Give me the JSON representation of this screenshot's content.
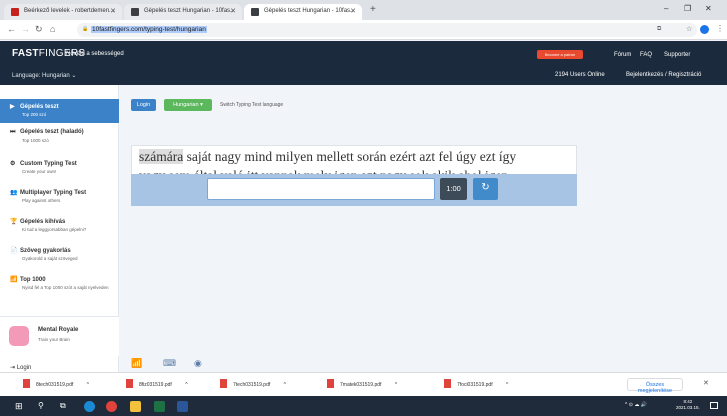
{
  "browser": {
    "tabs": [
      {
        "label": "Beérkező levelek - robertdemen...",
        "color": "#c5221f"
      },
      {
        "label": "Gépelés teszt Hungarian - 10fas...",
        "color": "#3b3f44"
      },
      {
        "label": "Gépelés teszt Hungarian - 10fas...",
        "color": "#3b3f44"
      }
    ],
    "new_tab": "+",
    "url": "10fastfingers.com/typing-test/hungarian",
    "window_controls": [
      "–",
      "❐",
      "✕"
    ]
  },
  "header": {
    "logo_bold": "FAST",
    "logo_thin": "FINGERS",
    "slogan": "Növeld a sebességed",
    "language": "Language: Hungarian",
    "patron": "Become a patron",
    "links": [
      "Fórum",
      "FAQ",
      "Supporter"
    ],
    "users_online": "2194 Users Online",
    "login_register": "Bejelentkezés / Regisztráció"
  },
  "sidebar": {
    "items": [
      {
        "title": "Gépelés teszt",
        "desc": "Top 200 szó",
        "icon": "▶"
      },
      {
        "title": "Gépelés teszt (haladó)",
        "desc": "Top 1000 szó",
        "icon": "⏭"
      },
      {
        "title": "Custom Typing Test",
        "desc": "Create your own!",
        "icon": "⚙"
      },
      {
        "title": "Multiplayer Typing Test",
        "desc": "Play against others",
        "icon": "👥"
      },
      {
        "title": "Gépelés kihívás",
        "desc": "Ki tud a leggyorsabban gépelni?",
        "icon": "🏆"
      },
      {
        "title": "Szöveg gyakorlás",
        "desc": "Gyakorold a saját szöveged",
        "icon": "📄"
      },
      {
        "title": "Top 1000",
        "desc": "Nyisd fel a Top 1000 szót a saját nyelveden",
        "icon": "📶"
      }
    ],
    "mental_title": "Mental Royale",
    "mental_desc": "Train your Brain",
    "login": "Login"
  },
  "main": {
    "login_btn": "Login",
    "language_btn": "Hungarian",
    "switch_text": "Switch Typing Test language",
    "current_word": "számára",
    "line1_rest": "saját nagy mind milyen mellett során ezért azt fel úgy ezt így",
    "line2": "vagy sem által való itt vannak mely igen azt nagy sok akik ahol igen",
    "timer": "1:00",
    "reset_icon": "↻"
  },
  "downloads": {
    "files": [
      "8tech031519.pdf",
      "8fiz031519.pdf",
      "7tech031519.pdf",
      "7matek031519.pdf",
      "7foci031519.pdf"
    ],
    "show_all": "Összes megjelenítése",
    "close": "✕"
  },
  "taskbar": {
    "time": "8:42",
    "date": "2021.03.15."
  },
  "colors": {
    "header_bg": "#1b2a3c",
    "active_blue": "#3b82c8",
    "green_btn": "#5cb85c",
    "timer_bg": "#3d4a58"
  }
}
